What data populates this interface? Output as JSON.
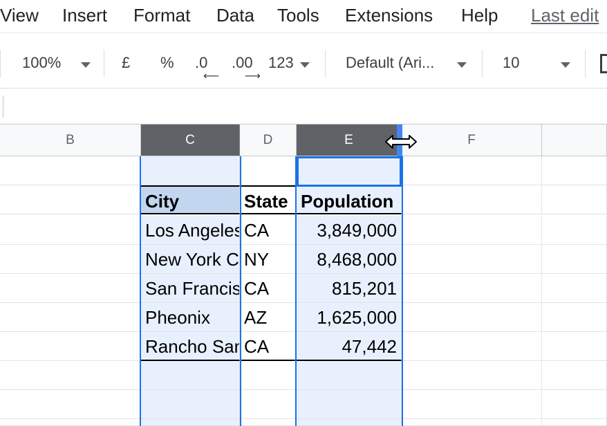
{
  "menu": {
    "items": [
      "View",
      "Insert",
      "Format",
      "Data",
      "Tools",
      "Extensions",
      "Help"
    ],
    "last_edit": "Last edit"
  },
  "toolbar": {
    "zoom": "100%",
    "currency": "£",
    "percent": "%",
    "decrease_decimal": ".0",
    "increase_decimal": ".00",
    "more_formats": "123",
    "font": "Default (Ari...",
    "font_size": "10"
  },
  "columns": [
    "B",
    "C",
    "D",
    "E",
    "F"
  ],
  "table": {
    "headers": [
      "City",
      "State",
      "Population"
    ],
    "rows": [
      [
        "Los Angeles",
        "CA",
        "3,849,000"
      ],
      [
        "New York City",
        "NY",
        "8,468,000"
      ],
      [
        "San Francisco",
        "CA",
        "815,201"
      ],
      [
        "Pheonix",
        "AZ",
        "1,625,000"
      ],
      [
        "Rancho Santa Margarita",
        "CA",
        "47,442"
      ]
    ]
  },
  "colors": {
    "selection": "#1a73e8",
    "selected_header": "#5f6368",
    "header_fill": "#c2d6f0"
  }
}
